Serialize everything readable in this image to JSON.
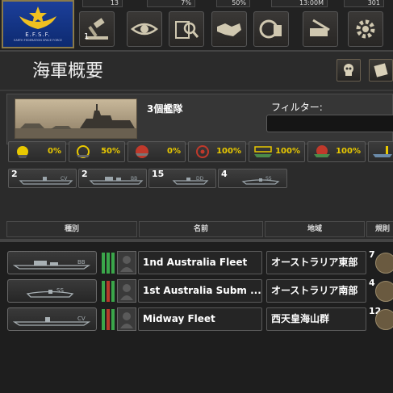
{
  "country": {
    "flag_name": "E.F.S.F.",
    "flag_subtitle": "EARTH FEDERATION SPACE FORCE"
  },
  "stats": [
    "13",
    "7%",
    "50%",
    "13:00M",
    "301"
  ],
  "toolbar": {
    "buttons": [
      {
        "icon": "gavel-icon"
      },
      {
        "icon": "eye-icon"
      },
      {
        "icon": "research-icon"
      },
      {
        "icon": "handshake-icon"
      },
      {
        "icon": "production-icon"
      },
      {
        "icon": "logistics-icon"
      },
      {
        "icon": "settings-icon"
      }
    ],
    "first_badge": "1"
  },
  "panel": {
    "title": "海軍概要",
    "fleet_count": "3個艦隊",
    "filter_label": "フィルター:"
  },
  "categories": [
    {
      "icon": "naval-supremacy-icon",
      "value": "0%"
    },
    {
      "icon": "supply-icon",
      "value": "50%"
    },
    {
      "icon": "strike-icon",
      "value": "0%"
    },
    {
      "icon": "target-icon",
      "value": "100%"
    },
    {
      "icon": "convoy-icon",
      "value": "100%"
    },
    {
      "icon": "patrol-icon",
      "value": "100%"
    },
    {
      "icon": "submarine-hunt-icon",
      "value": ""
    }
  ],
  "ship_types": [
    {
      "count": "2",
      "code": "CV"
    },
    {
      "count": "2",
      "code": "BB"
    },
    {
      "count": "15",
      "code": "DD"
    },
    {
      "count": "4",
      "code": "SS"
    }
  ],
  "columns": {
    "type": "種別",
    "name": "名前",
    "region": "地域",
    "rules": "規則"
  },
  "fleets": [
    {
      "code": "BB",
      "name": "1nd Australia Fleet",
      "region": "オーストラリア東部",
      "count": "7"
    },
    {
      "code": "SS",
      "name": "1st Australia Subm ...",
      "region": "オーストラリア南部",
      "count": "4"
    },
    {
      "code": "CV",
      "name": "Midway Fleet",
      "region": "西天皇海山群",
      "count": "12"
    }
  ],
  "colors": {
    "accent_gold": "#e8c800",
    "readiness_green": "#3aa64a",
    "readiness_red": "#b83a2a"
  }
}
